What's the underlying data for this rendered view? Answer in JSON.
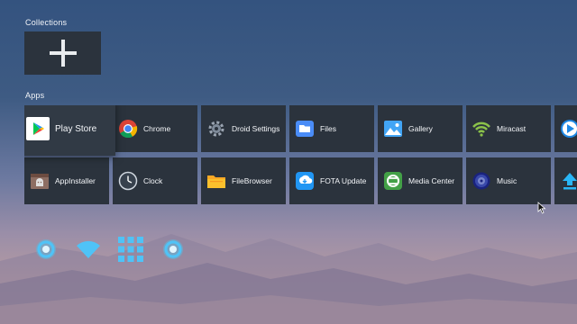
{
  "collections": {
    "label": "Collections",
    "add_icon": "plus-icon"
  },
  "apps": {
    "label": "Apps",
    "items": [
      {
        "label": "Play Store",
        "icon": "play-store-icon",
        "focused": true
      },
      {
        "label": "Chrome",
        "icon": "chrome-icon"
      },
      {
        "label": "Droid Settings",
        "icon": "gear-icon"
      },
      {
        "label": "Files",
        "icon": "folder-icon"
      },
      {
        "label": "Gallery",
        "icon": "gallery-icon"
      },
      {
        "label": "Miracast",
        "icon": "miracast-icon"
      },
      {
        "label": "",
        "icon": "media-player-icon"
      },
      {
        "label": "AppInstaller",
        "icon": "app-installer-icon"
      },
      {
        "label": "Clock",
        "icon": "clock-icon"
      },
      {
        "label": "FileBrowser",
        "icon": "file-browser-icon"
      },
      {
        "label": "FOTA Update",
        "icon": "fota-update-icon"
      },
      {
        "label": "Media Center",
        "icon": "media-center-icon"
      },
      {
        "label": "Music",
        "icon": "music-icon"
      },
      {
        "label": "",
        "icon": "upload-icon"
      }
    ]
  },
  "status_bar": {
    "icons": [
      "ethernet-status-icon",
      "wifi-icon",
      "apps-grid-icon",
      "settings-status-icon"
    ]
  },
  "colors": {
    "tile": "#2b333d",
    "accent": "#29b6f6"
  }
}
